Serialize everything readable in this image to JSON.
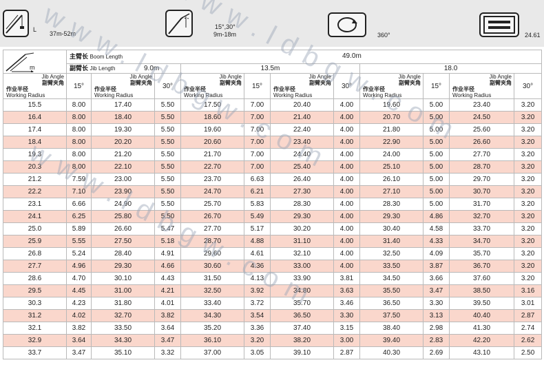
{
  "banner": {
    "item1": {
      "text": "37m-52m",
      "label": "L"
    },
    "item2": {
      "line1": "15°,30°",
      "line2": "9m-18m"
    },
    "item3": {
      "text": "360°"
    },
    "item4": {
      "text": "24.61"
    }
  },
  "header": {
    "boom_cn": "主臂长",
    "boom_en": "Boom Length",
    "boom_value": "49.0m",
    "jib_cn": "副臂长",
    "jib_en": "Jib Length",
    "jib_values": [
      "9.0m",
      "13.5m",
      "18.0"
    ],
    "m_label": "m",
    "radius_cn": "作业半径",
    "radius_en": "Working Radius",
    "jibangle_en": "Jib Angle",
    "jibangle_cn": "副臂夹角",
    "angle15": "15°",
    "angle30": "30°"
  },
  "rows": [
    [
      "15.5",
      "8.00",
      "17.40",
      "5.50",
      "17.50",
      "7.00",
      "20.40",
      "4.00",
      "19.60",
      "5.00",
      "23.40",
      "3.20"
    ],
    [
      "16.4",
      "8.00",
      "18.40",
      "5.50",
      "18.60",
      "7.00",
      "21.40",
      "4.00",
      "20.70",
      "5.00",
      "24.50",
      "3.20"
    ],
    [
      "17.4",
      "8.00",
      "19.30",
      "5.50",
      "19.60",
      "7.00",
      "22.40",
      "4.00",
      "21.80",
      "5.00",
      "25.60",
      "3.20"
    ],
    [
      "18.4",
      "8.00",
      "20.20",
      "5.50",
      "20.60",
      "7.00",
      "23.40",
      "4.00",
      "22.90",
      "5.00",
      "26.60",
      "3.20"
    ],
    [
      "19.3",
      "8.00",
      "21.20",
      "5.50",
      "21.70",
      "7.00",
      "24.40",
      "4.00",
      "24.00",
      "5.00",
      "27.70",
      "3.20"
    ],
    [
      "20.3",
      "8.00",
      "22.10",
      "5.50",
      "22.70",
      "7.00",
      "25.40",
      "4.00",
      "25.10",
      "5.00",
      "28.70",
      "3.20"
    ],
    [
      "21.2",
      "7.59",
      "23.00",
      "5.50",
      "23.70",
      "6.63",
      "26.40",
      "4.00",
      "26.10",
      "5.00",
      "29.70",
      "3.20"
    ],
    [
      "22.2",
      "7.10",
      "23.90",
      "5.50",
      "24.70",
      "6.21",
      "27.30",
      "4.00",
      "27.10",
      "5.00",
      "30.70",
      "3.20"
    ],
    [
      "23.1",
      "6.66",
      "24.90",
      "5.50",
      "25.70",
      "5.83",
      "28.30",
      "4.00",
      "28.30",
      "5.00",
      "31.70",
      "3.20"
    ],
    [
      "24.1",
      "6.25",
      "25.80",
      "5.50",
      "26.70",
      "5.49",
      "29.30",
      "4.00",
      "29.30",
      "4.86",
      "32.70",
      "3.20"
    ],
    [
      "25.0",
      "5.89",
      "26.60",
      "5.47",
      "27.70",
      "5.17",
      "30.20",
      "4.00",
      "30.40",
      "4.58",
      "33.70",
      "3.20"
    ],
    [
      "25.9",
      "5.55",
      "27.50",
      "5.18",
      "28.70",
      "4.88",
      "31.10",
      "4.00",
      "31.40",
      "4.33",
      "34.70",
      "3.20"
    ],
    [
      "26.8",
      "5.24",
      "28.40",
      "4.91",
      "29.60",
      "4.61",
      "32.10",
      "4.00",
      "32.50",
      "4.09",
      "35.70",
      "3.20"
    ],
    [
      "27.7",
      "4.96",
      "29.30",
      "4.66",
      "30.60",
      "4.36",
      "33.00",
      "4.00",
      "33.50",
      "3.87",
      "36.70",
      "3.20"
    ],
    [
      "28.6",
      "4.70",
      "30.10",
      "4.43",
      "31.50",
      "4.13",
      "33.90",
      "3.81",
      "34.50",
      "3.66",
      "37.60",
      "3.20"
    ],
    [
      "29.5",
      "4.45",
      "31.00",
      "4.21",
      "32.50",
      "3.92",
      "34.80",
      "3.63",
      "35.50",
      "3.47",
      "38.50",
      "3.16"
    ],
    [
      "30.3",
      "4.23",
      "31.80",
      "4.01",
      "33.40",
      "3.72",
      "35.70",
      "3.46",
      "36.50",
      "3.30",
      "39.50",
      "3.01"
    ],
    [
      "31.2",
      "4.02",
      "32.70",
      "3.82",
      "34.30",
      "3.54",
      "36.50",
      "3.30",
      "37.50",
      "3.13",
      "40.40",
      "2.87"
    ],
    [
      "32.1",
      "3.82",
      "33.50",
      "3.64",
      "35.20",
      "3.36",
      "37.40",
      "3.15",
      "38.40",
      "2.98",
      "41.30",
      "2.74"
    ],
    [
      "32.9",
      "3.64",
      "34.30",
      "3.47",
      "36.10",
      "3.20",
      "38.20",
      "3.00",
      "39.40",
      "2.83",
      "42.20",
      "2.62"
    ],
    [
      "33.7",
      "3.47",
      "35.10",
      "3.32",
      "37.00",
      "3.05",
      "39.10",
      "2.87",
      "40.30",
      "2.69",
      "43.10",
      "2.50"
    ]
  ],
  "watermark": {
    "lines": [
      "www.ldbgw.com",
      "www.ldbgw.com",
      "www.ldbgw.com"
    ]
  }
}
